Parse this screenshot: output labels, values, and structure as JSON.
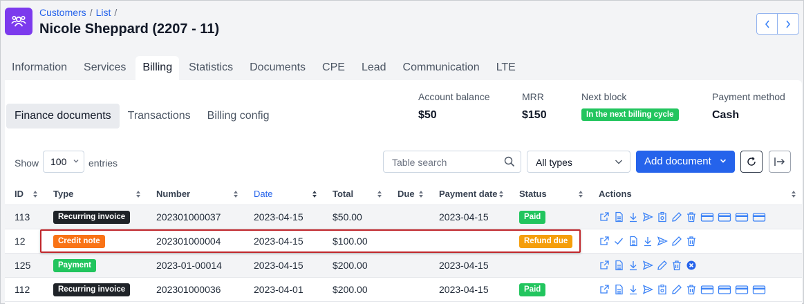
{
  "breadcrumb": {
    "items": [
      "Customers",
      "List"
    ]
  },
  "header": {
    "title": "Nicole Sheppard (2207 - 11)"
  },
  "tabs": [
    "Information",
    "Services",
    "Billing",
    "Statistics",
    "Documents",
    "CPE",
    "Lead",
    "Communication",
    "LTE"
  ],
  "active_tab": "Billing",
  "subtabs": [
    "Finance documents",
    "Transactions",
    "Billing config"
  ],
  "active_subtab": "Finance documents",
  "stats": {
    "account_balance": {
      "label": "Account balance",
      "value": "$50"
    },
    "mrr": {
      "label": "MRR",
      "value": "$150"
    },
    "next_block": {
      "label": "Next block",
      "value": "In the next billing cycle"
    },
    "payment_method": {
      "label": "Payment method",
      "value": "Cash"
    }
  },
  "controls": {
    "show_label": "Show",
    "entries_value": "100",
    "entries_label": "entries",
    "search_placeholder": "Table search",
    "types_value": "All types",
    "add_document_label": "Add document"
  },
  "table": {
    "columns": [
      "ID",
      "Type",
      "Number",
      "Date",
      "Total",
      "Due",
      "Payment date",
      "Status",
      "Actions"
    ],
    "rows": [
      {
        "id": "113",
        "type": "Recurring invoice",
        "type_color": "dark",
        "number": "202301000037",
        "date": "2023-04-15",
        "total": "$50.00",
        "due": "",
        "payment_date": "2023-04-15",
        "status": "Paid",
        "status_color": "green"
      },
      {
        "id": "12",
        "type": "Credit note",
        "type_color": "orange",
        "number": "202301000004",
        "date": "2023-04-15",
        "total": "$100.00",
        "due": "",
        "payment_date": "",
        "status": "Refund due",
        "status_color": "amber"
      },
      {
        "id": "125",
        "type": "Payment",
        "type_color": "green",
        "number": "2023-01-00014",
        "date": "2023-04-15",
        "total": "$200.00",
        "due": "",
        "payment_date": "2023-04-15",
        "status": "",
        "status_color": ""
      },
      {
        "id": "112",
        "type": "Recurring invoice",
        "type_color": "dark",
        "number": "202301000036",
        "date": "2023-04-01",
        "total": "$200.00",
        "due": "",
        "payment_date": "2023-04-15",
        "status": "Paid",
        "status_color": "green"
      }
    ]
  },
  "colors": {
    "accent": "#2563eb",
    "brand": "#7c3aed",
    "highlight": "#c0262b"
  },
  "icons": [
    "users-icon",
    "chevron-left-icon",
    "chevron-right-icon",
    "search-icon",
    "chevron-down-icon",
    "refresh-icon",
    "export-icon",
    "open-external-icon",
    "pdf-icon",
    "download-icon",
    "send-icon",
    "clipboard-icon",
    "edit-icon",
    "trash-icon",
    "card-icon",
    "check-icon",
    "close-circle-icon",
    "sort-icon"
  ]
}
